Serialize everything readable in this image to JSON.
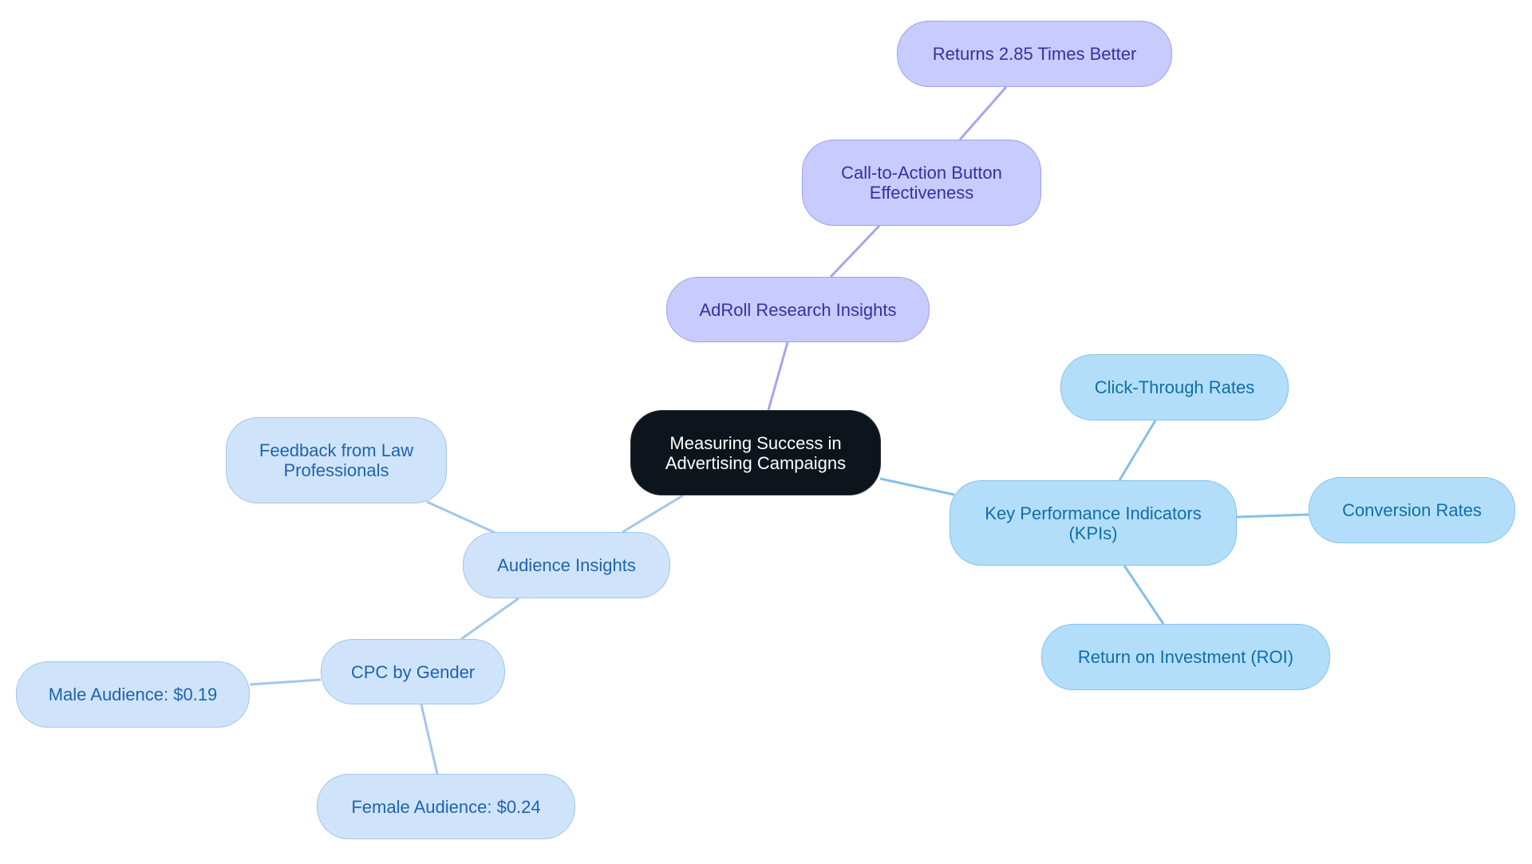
{
  "diagram": {
    "type": "mindmap",
    "colors": {
      "root_fill": "#0d141b",
      "root_text": "#ffffff",
      "purple_fill": "#c8cbfd",
      "purple_text": "#3730a3",
      "purple_edge": "#a5a6ea",
      "sky_fill": "#b3defa",
      "sky_text": "#0f6fa8",
      "sky_edge": "#84c0e8",
      "blue_fill": "#cfe4fb",
      "blue_text": "#1f63ad",
      "blue_edge": "#a3c6ec"
    },
    "root": {
      "label": "Measuring Success in Advertising Campaigns"
    },
    "nodes": {
      "adroll": {
        "label": "AdRoll Research Insights"
      },
      "cta": {
        "label": "Call-to-Action Button Effectiveness"
      },
      "returns": {
        "label": "Returns 2.85 Times Better"
      },
      "kpis": {
        "label": "Key Performance Indicators (KPIs)"
      },
      "ctr": {
        "label": "Click-Through Rates"
      },
      "conversion": {
        "label": "Conversion Rates"
      },
      "roi": {
        "label": "Return on Investment (ROI)"
      },
      "audience": {
        "label": "Audience Insights"
      },
      "feedback": {
        "label": "Feedback from Law Professionals"
      },
      "cpc": {
        "label": "CPC by Gender"
      },
      "male": {
        "label": "Male Audience: $0.19"
      },
      "female": {
        "label": "Female Audience: $0.24"
      }
    },
    "edges": [
      [
        "root",
        "adroll"
      ],
      [
        "adroll",
        "cta"
      ],
      [
        "cta",
        "returns"
      ],
      [
        "root",
        "kpis"
      ],
      [
        "kpis",
        "ctr"
      ],
      [
        "kpis",
        "conversion"
      ],
      [
        "kpis",
        "roi"
      ],
      [
        "root",
        "audience"
      ],
      [
        "audience",
        "feedback"
      ],
      [
        "audience",
        "cpc"
      ],
      [
        "cpc",
        "male"
      ],
      [
        "cpc",
        "female"
      ]
    ]
  }
}
